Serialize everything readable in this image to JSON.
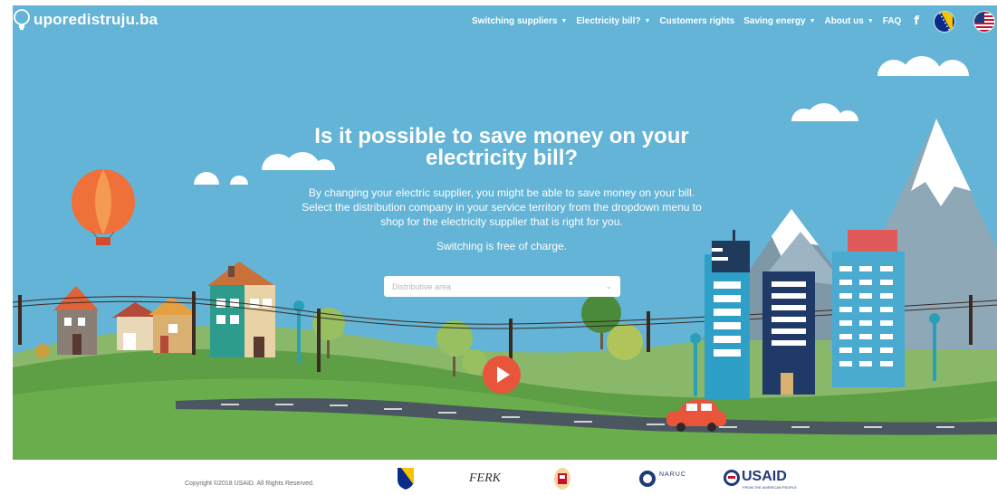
{
  "brand": {
    "name": "uporedistruju.ba"
  },
  "nav": {
    "items": [
      {
        "label": "Switching suppliers",
        "has_dropdown": true
      },
      {
        "label": "Electricity bill?",
        "has_dropdown": true
      },
      {
        "label": "Customers rights",
        "has_dropdown": false
      },
      {
        "label": "Saving energy",
        "has_dropdown": true
      },
      {
        "label": "About us",
        "has_dropdown": true
      },
      {
        "label": "FAQ",
        "has_dropdown": false
      }
    ],
    "social_icon": "facebook-icon",
    "language_flags": [
      "bosnia-flag",
      "usa-flag"
    ]
  },
  "hero": {
    "headline": "Is it possible to save money on your electricity bill?",
    "description": "By changing your electric supplier, you might be able to save money on your bill. Select the distribution company in your service territory from the dropdown menu to shop for the electricity supplier that is right for you.",
    "note": "Switching is free of charge.",
    "dropdown_placeholder": "Distributive area",
    "play_icon": "play-icon"
  },
  "footer": {
    "copyright": "Copyright ©2018 USAID. All Rights Reserved.",
    "logos": [
      "bih-coat-of-arms",
      "FERK",
      "rs-coat-of-arms",
      "NARUC",
      "USAID"
    ],
    "ferk_text": "FERK",
    "naruc_text": "NARUC",
    "usaid_text": "USAID",
    "usaid_tagline": "FROM THE AMERICAN PEOPLE"
  },
  "colors": {
    "sky": "#63b4d6",
    "play_button": "#e8553b",
    "ground": "#5e9e44"
  }
}
